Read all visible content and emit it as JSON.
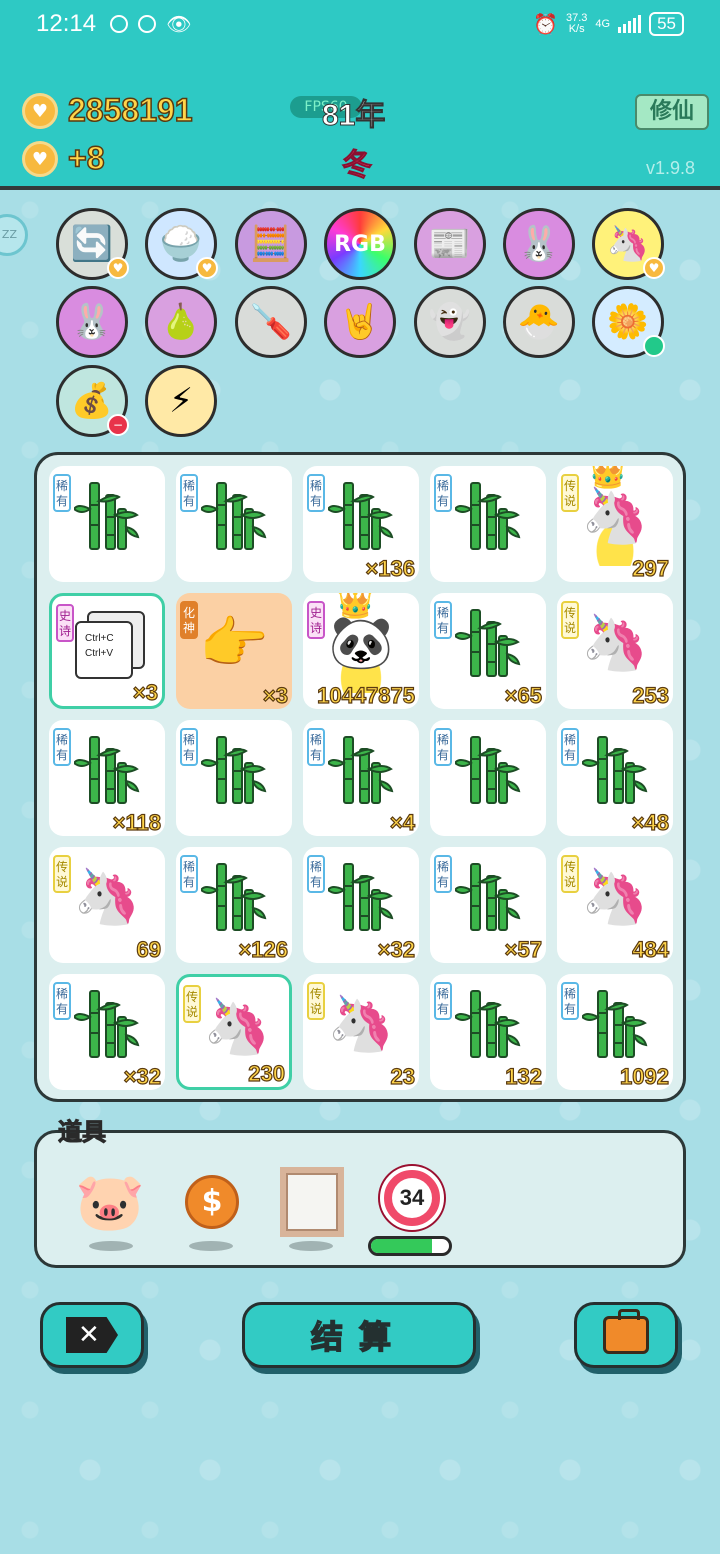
{
  "status_bar": {
    "time": "12:14",
    "net_speed": "37.3",
    "net_unit": "K/s",
    "network": "4G",
    "battery": "55"
  },
  "header": {
    "coins": "2858191",
    "income": "+8",
    "fps_label": "FPS60",
    "year": "81年",
    "season": "冬",
    "xiuxian_button": "修仙",
    "version": "v1.9.8",
    "side_tab": "ZZ"
  },
  "relics": [
    {
      "name": "refresh-relic-icon",
      "glyph": "🔄",
      "bg": "#d9dfd9"
    },
    {
      "name": "rice-bowl-relic-icon",
      "glyph": "🍚",
      "bg": "#cfe7ff"
    },
    {
      "name": "math-brain-relic-icon",
      "glyph": "🧮",
      "bg": "#c89ae0"
    },
    {
      "name": "rgb-relic-icon",
      "glyph": "RGB",
      "bg": "#ff6060"
    },
    {
      "name": "time-magazine-relic-icon",
      "glyph": "📰",
      "bg": "#d9a0e0"
    },
    {
      "name": "bunny-card-relic-icon",
      "glyph": "🐰",
      "bg": "#d98ce0"
    },
    {
      "name": "unicorn-relic-icon",
      "glyph": "🦄",
      "bg": "#fff27a"
    },
    {
      "name": "bunny-frame-relic-icon",
      "glyph": "🐰",
      "bg": "#d98ce0"
    },
    {
      "name": "grapefruit-relic-icon",
      "glyph": "🍐",
      "bg": "#d9a0e0"
    },
    {
      "name": "screwdriver-relic-icon",
      "glyph": "🪛",
      "bg": "#d9dcd9"
    },
    {
      "name": "rock-hand-relic-icon",
      "glyph": "🤘",
      "bg": "#d9a0e0"
    },
    {
      "name": "ghost-relic-icon",
      "glyph": "👻",
      "bg": "#d9dcd9"
    },
    {
      "name": "chick-egg-relic-icon",
      "glyph": "🐣",
      "bg": "#d9dcd9"
    },
    {
      "name": "flower-pot-relic-icon",
      "glyph": "🌼",
      "bg": "#d4ecff"
    },
    {
      "name": "money-sack-relic-icon",
      "glyph": "💰",
      "bg": "#bfe6df"
    },
    {
      "name": "lightning-relic-icon",
      "glyph": "⚡",
      "bg": "#ffe9a6"
    }
  ],
  "grid": [
    {
      "rarity": "稀有",
      "kind": "bamboo",
      "count": ""
    },
    {
      "rarity": "稀有",
      "kind": "bamboo",
      "count": ""
    },
    {
      "rarity": "稀有",
      "kind": "bamboo",
      "count": "×136"
    },
    {
      "rarity": "稀有",
      "kind": "bamboo",
      "count": ""
    },
    {
      "rarity": "传说",
      "kind": "unicorn-crown",
      "count": "297"
    },
    {
      "rarity": "史诗",
      "kind": "copy-paste",
      "count": "×3",
      "selected": true,
      "copy_text": "Ctrl+C\nCtrl+V"
    },
    {
      "rarity": "化神",
      "kind": "pointing-hand",
      "count": "×3",
      "orange": true
    },
    {
      "rarity": "史诗",
      "kind": "panda-crown",
      "count": "10447875"
    },
    {
      "rarity": "稀有",
      "kind": "bamboo",
      "count": "×65"
    },
    {
      "rarity": "传说",
      "kind": "unicorn",
      "count": "253"
    },
    {
      "rarity": "稀有",
      "kind": "bamboo",
      "count": "×118"
    },
    {
      "rarity": "稀有",
      "kind": "bamboo",
      "count": ""
    },
    {
      "rarity": "稀有",
      "kind": "bamboo",
      "count": "×4"
    },
    {
      "rarity": "稀有",
      "kind": "bamboo",
      "count": ""
    },
    {
      "rarity": "稀有",
      "kind": "bamboo",
      "count": "×48"
    },
    {
      "rarity": "传说",
      "kind": "unicorn",
      "count": "69"
    },
    {
      "rarity": "稀有",
      "kind": "bamboo",
      "count": "×126"
    },
    {
      "rarity": "稀有",
      "kind": "bamboo",
      "count": "×32"
    },
    {
      "rarity": "稀有",
      "kind": "bamboo",
      "count": "×57"
    },
    {
      "rarity": "传说",
      "kind": "unicorn",
      "count": "484"
    },
    {
      "rarity": "稀有",
      "kind": "bamboo",
      "count": "×32"
    },
    {
      "rarity": "传说",
      "kind": "unicorn",
      "count": "230",
      "selected": true
    },
    {
      "rarity": "传说",
      "kind": "unicorn",
      "count": "23"
    },
    {
      "rarity": "稀有",
      "kind": "bamboo",
      "count": "132"
    },
    {
      "rarity": "稀有",
      "kind": "bamboo",
      "count": "1092"
    }
  ],
  "items_panel": {
    "title": "道具",
    "items": [
      {
        "name": "piggy-bank-icon",
        "glyph": "🐷"
      },
      {
        "name": "dollar-coin-icon",
        "glyph": "$"
      },
      {
        "name": "mirror-frame-icon",
        "glyph": ""
      }
    ],
    "bottle_count": "34",
    "bottle_progress": 0.78
  },
  "buttons": {
    "close": "✕",
    "settle": "结算",
    "bag_icon": "briefcase-icon"
  }
}
